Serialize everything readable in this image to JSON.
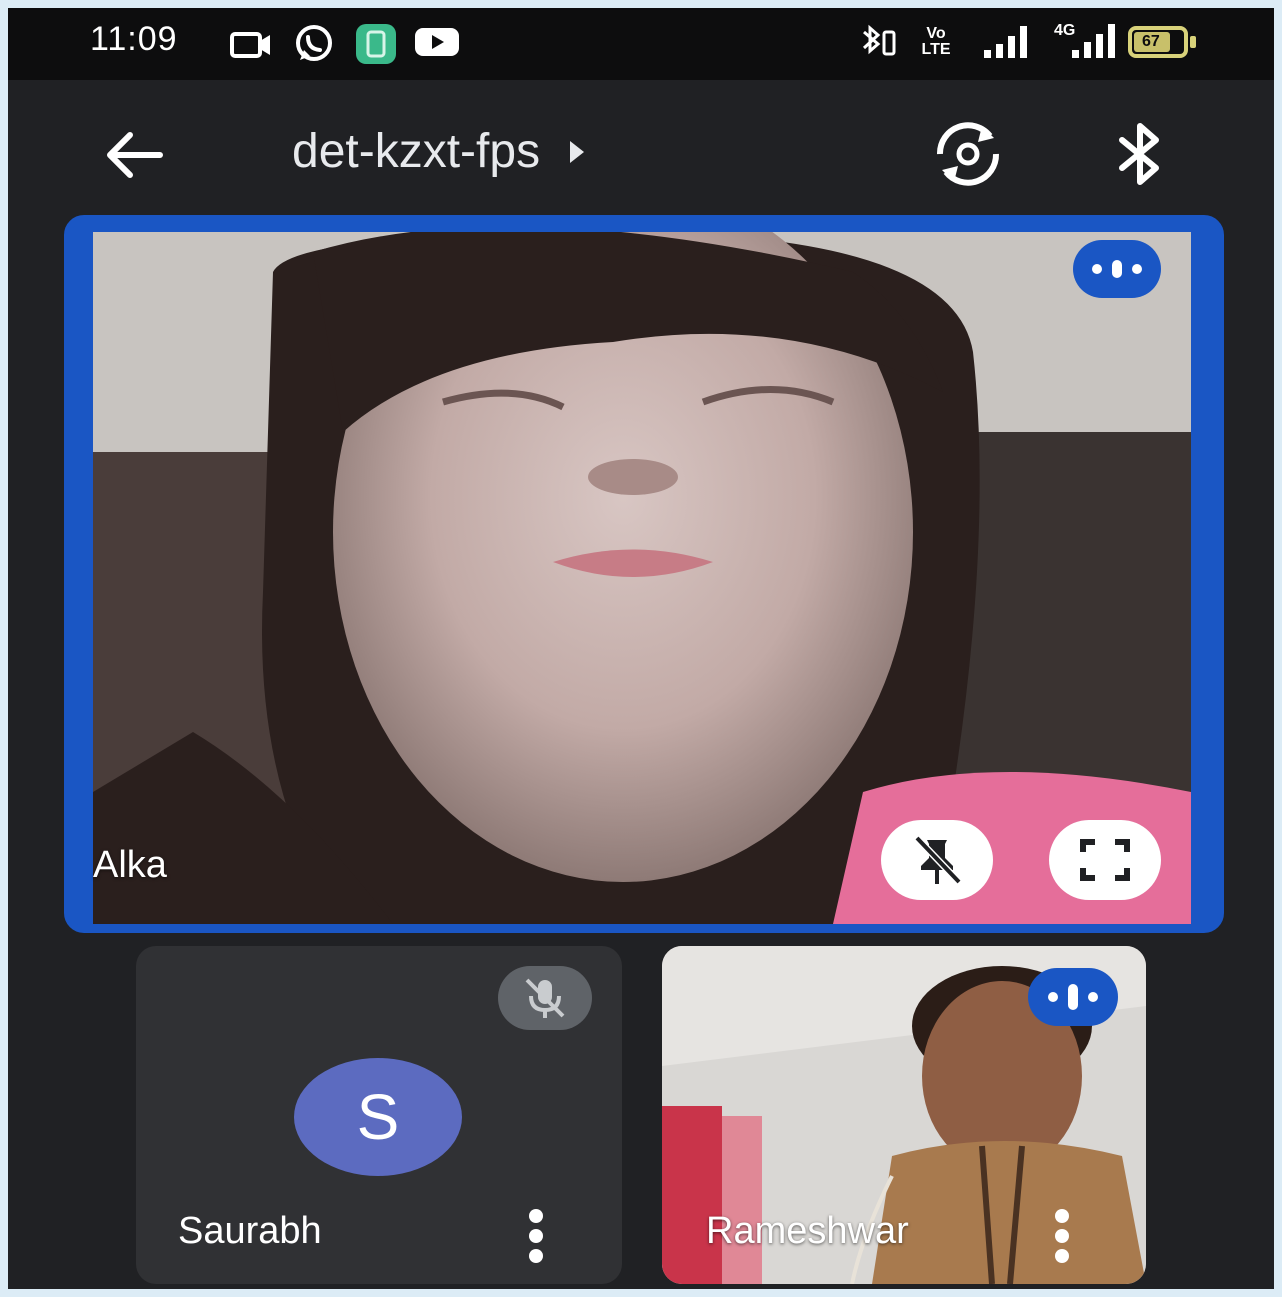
{
  "status_bar": {
    "time": "11:09",
    "left_icons": [
      "camera-icon",
      "whatsapp-icon",
      "app-icon",
      "youtube-icon"
    ],
    "right_icons": [
      "bluetooth-vibrate-icon",
      "volte-icon",
      "signal-icon",
      "4g-signal-icon",
      "battery-icon"
    ],
    "network": "4G",
    "volte_label": "Vo LTE",
    "battery": "67"
  },
  "top_bar": {
    "meeting_code": "det-kzxt-fps",
    "icons": [
      "back-arrow-icon",
      "switch-camera-icon",
      "bluetooth-icon"
    ]
  },
  "participants": [
    {
      "name": "Alka",
      "state": "speaking",
      "pinned": true,
      "icons": [
        "speaking-indicator-icon",
        "unpin-icon",
        "fullscreen-icon"
      ]
    },
    {
      "name": "Saurabh",
      "avatar_initial": "S",
      "state": "muted",
      "icons": [
        "mic-off-icon",
        "more-vert-icon"
      ]
    },
    {
      "name": "Rameshwar",
      "state": "speaking",
      "icons": [
        "speaking-indicator-icon",
        "more-vert-icon"
      ]
    }
  ],
  "colors": {
    "background": "#202124",
    "accent": "#1a56c4",
    "avatar": "#5c6bc0",
    "muted_badge": "#5f6368"
  }
}
